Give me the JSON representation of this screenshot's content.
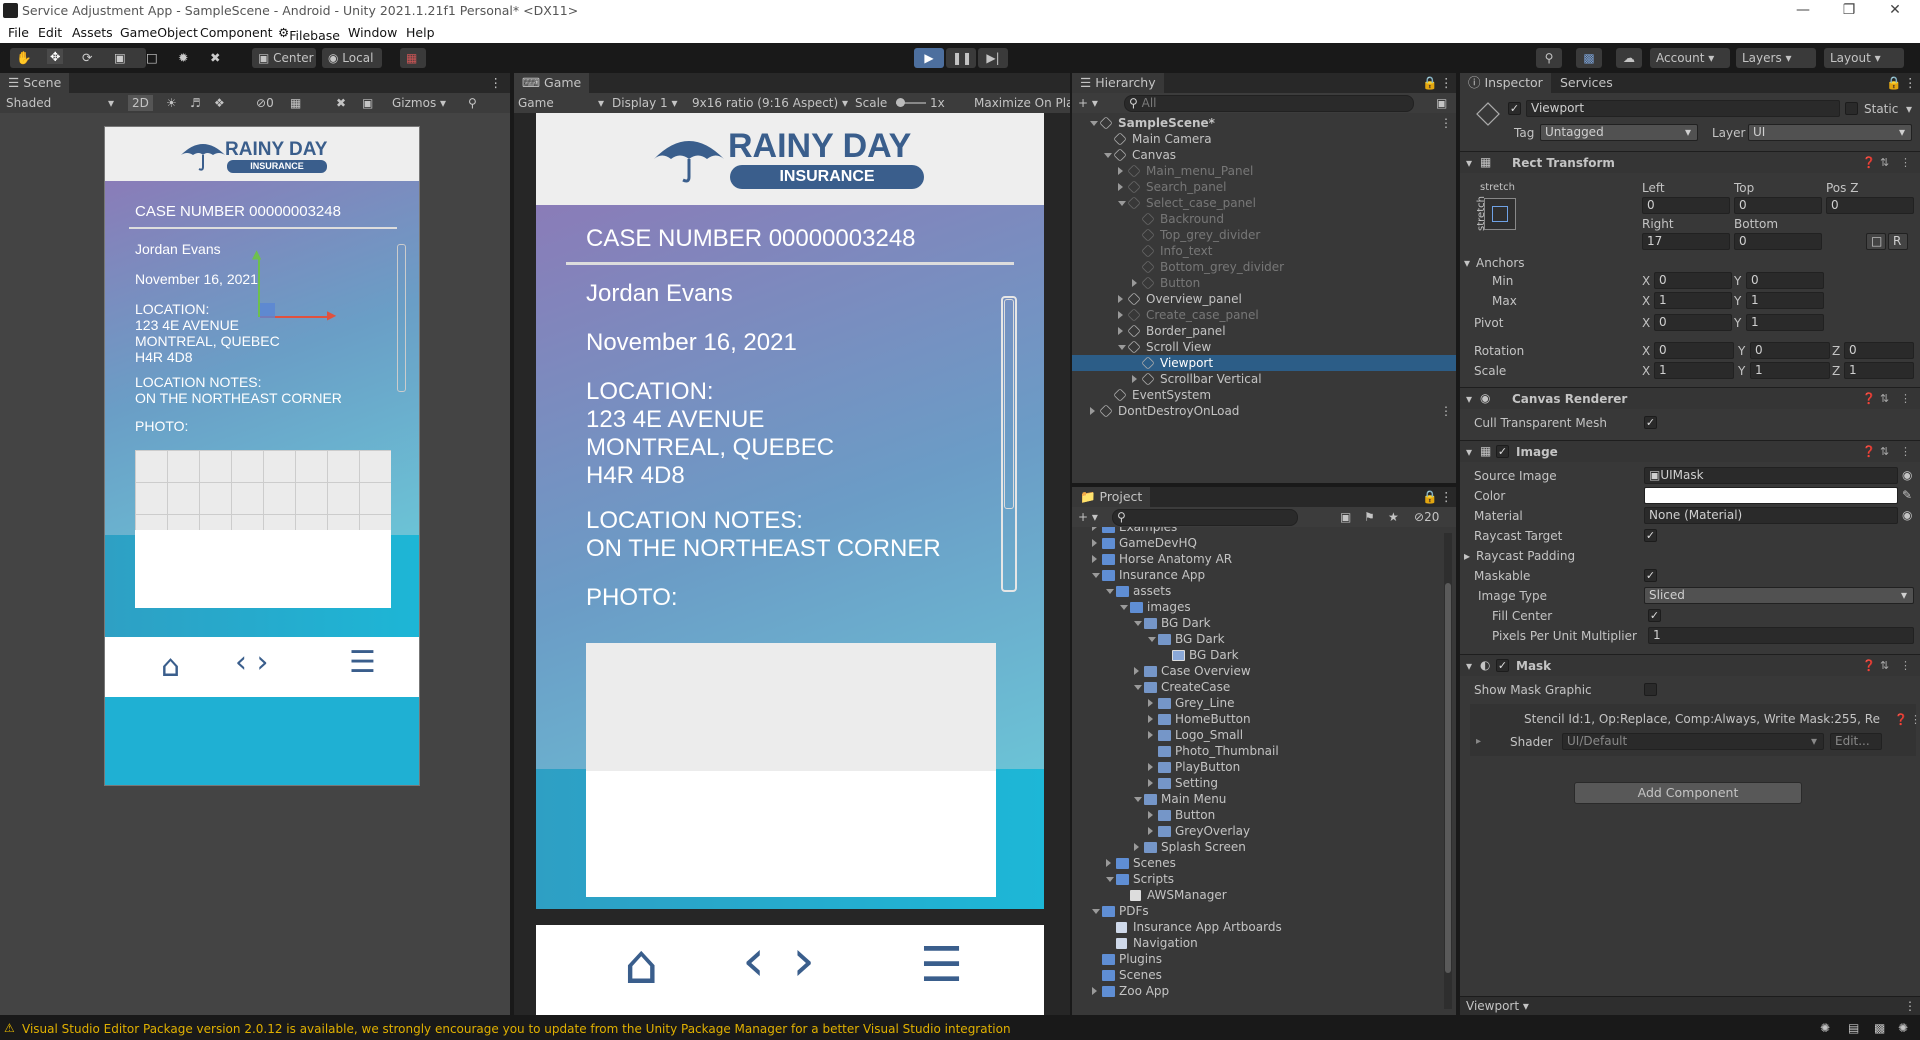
{
  "window": {
    "title": "Service Adjustment App - SampleScene - Android - Unity 2021.1.21f1 Personal* <DX11>"
  },
  "menu": [
    "File",
    "Edit",
    "Assets",
    "GameObject",
    "Component",
    "Filebase",
    "Window",
    "Help"
  ],
  "toolbar": {
    "center": "Center",
    "local": "Local",
    "account": "Account",
    "layers": "Layers",
    "layout": "Layout"
  },
  "scene": {
    "tab": "Scene",
    "shading": "Shaded",
    "mode2d": "2D",
    "gizmos": "Gizmos",
    "hidden_count": "0",
    "search": "All"
  },
  "game": {
    "tab": "Game",
    "view": "Game",
    "display": "Display 1",
    "aspect": "9x16 ratio (9:16 Aspect)",
    "scale_label": "Scale",
    "scale_value": "1x",
    "maximize": "Maximize On Pla"
  },
  "app": {
    "brand1": "RAINY DAY",
    "brand2": "INSURANCE",
    "case": "CASE NUMBER 00000003248",
    "name": "Jordan Evans",
    "date": "November 16, 2021",
    "loc_label": "LOCATION:",
    "loc1": "123 4E AVENUE",
    "loc2": "MONTREAL, QUEBEC",
    "loc3": "H4R 4D8",
    "notes_label": "LOCATION NOTES:",
    "notes": "ON THE NORTHEAST CORNER",
    "photo": "PHOTO:"
  },
  "hierarchy": {
    "tab": "Hierarchy",
    "search": "All",
    "items": [
      {
        "label": "SampleScene*",
        "depth": 0,
        "open": true,
        "dim": false,
        "kind": "scene"
      },
      {
        "label": "Main Camera",
        "depth": 1,
        "open": null,
        "dim": false,
        "kind": "go"
      },
      {
        "label": "Canvas",
        "depth": 1,
        "open": true,
        "dim": false,
        "kind": "go"
      },
      {
        "label": "Main_menu_Panel",
        "depth": 2,
        "open": false,
        "dim": true,
        "kind": "go"
      },
      {
        "label": "Search_panel",
        "depth": 2,
        "open": false,
        "dim": true,
        "kind": "go"
      },
      {
        "label": "Select_case_panel",
        "depth": 2,
        "open": true,
        "dim": true,
        "kind": "go"
      },
      {
        "label": "Backround",
        "depth": 3,
        "open": null,
        "dim": true,
        "kind": "go"
      },
      {
        "label": "Top_grey_divider",
        "depth": 3,
        "open": null,
        "dim": true,
        "kind": "go"
      },
      {
        "label": "Info_text",
        "depth": 3,
        "open": null,
        "dim": true,
        "kind": "go"
      },
      {
        "label": "Bottom_grey_divider",
        "depth": 3,
        "open": null,
        "dim": true,
        "kind": "go"
      },
      {
        "label": "Button",
        "depth": 3,
        "open": false,
        "dim": true,
        "kind": "go"
      },
      {
        "label": "Overview_panel",
        "depth": 2,
        "open": false,
        "dim": false,
        "kind": "go"
      },
      {
        "label": "Create_case_panel",
        "depth": 2,
        "open": false,
        "dim": true,
        "kind": "go"
      },
      {
        "label": "Border_panel",
        "depth": 2,
        "open": false,
        "dim": false,
        "kind": "go"
      },
      {
        "label": "Scroll View",
        "depth": 2,
        "open": true,
        "dim": false,
        "kind": "go"
      },
      {
        "label": "Viewport",
        "depth": 3,
        "open": null,
        "dim": false,
        "kind": "go",
        "selected": true
      },
      {
        "label": "Scrollbar Vertical",
        "depth": 3,
        "open": false,
        "dim": false,
        "kind": "go"
      },
      {
        "label": "EventSystem",
        "depth": 1,
        "open": null,
        "dim": false,
        "kind": "go"
      },
      {
        "label": "DontDestroyOnLoad",
        "depth": 0,
        "open": false,
        "dim": false,
        "kind": "scene"
      }
    ]
  },
  "project": {
    "tab": "Project",
    "hidden_count": "20",
    "items": [
      {
        "label": "Examples",
        "depth": 1,
        "open": false,
        "kind": "folder"
      },
      {
        "label": "GameDevHQ",
        "depth": 1,
        "open": false,
        "kind": "folder"
      },
      {
        "label": "Horse Anatomy AR",
        "depth": 1,
        "open": false,
        "kind": "folder"
      },
      {
        "label": "Insurance App",
        "depth": 1,
        "open": true,
        "kind": "folder"
      },
      {
        "label": "assets",
        "depth": 2,
        "open": true,
        "kind": "folder"
      },
      {
        "label": "images",
        "depth": 3,
        "open": true,
        "kind": "folder"
      },
      {
        "label": "BG Dark",
        "depth": 4,
        "open": true,
        "kind": "image"
      },
      {
        "label": "BG Dark",
        "depth": 5,
        "open": true,
        "kind": "image"
      },
      {
        "label": "BG Dark",
        "depth": 6,
        "open": null,
        "kind": "sprite"
      },
      {
        "label": "Case Overview",
        "depth": 4,
        "open": false,
        "kind": "image"
      },
      {
        "label": "CreateCase",
        "depth": 4,
        "open": true,
        "kind": "image"
      },
      {
        "label": "Grey_Line",
        "depth": 5,
        "open": false,
        "kind": "image"
      },
      {
        "label": "HomeButton",
        "depth": 5,
        "open": false,
        "kind": "image"
      },
      {
        "label": "Logo_Small",
        "depth": 5,
        "open": false,
        "kind": "image"
      },
      {
        "label": "Photo_Thumbnail",
        "depth": 5,
        "open": null,
        "kind": "image"
      },
      {
        "label": "PlayButton",
        "depth": 5,
        "open": false,
        "kind": "image"
      },
      {
        "label": "Setting",
        "depth": 5,
        "open": false,
        "kind": "image"
      },
      {
        "label": "Main Menu",
        "depth": 4,
        "open": true,
        "kind": "image"
      },
      {
        "label": "Button",
        "depth": 5,
        "open": false,
        "kind": "image"
      },
      {
        "label": "GreyOverlay",
        "depth": 5,
        "open": false,
        "kind": "image"
      },
      {
        "label": "Splash Screen",
        "depth": 4,
        "open": false,
        "kind": "image"
      },
      {
        "label": "Scenes",
        "depth": 2,
        "open": false,
        "kind": "folder"
      },
      {
        "label": "Scripts",
        "depth": 2,
        "open": true,
        "kind": "folder"
      },
      {
        "label": "AWSManager",
        "depth": 3,
        "open": null,
        "kind": "script"
      },
      {
        "label": "PDFs",
        "depth": 1,
        "open": true,
        "kind": "folder"
      },
      {
        "label": "Insurance App Artboards",
        "depth": 2,
        "open": null,
        "kind": "pdf"
      },
      {
        "label": "Navigation",
        "depth": 2,
        "open": null,
        "kind": "pdf"
      },
      {
        "label": "Plugins",
        "depth": 1,
        "open": null,
        "kind": "folder"
      },
      {
        "label": "Scenes",
        "depth": 1,
        "open": null,
        "kind": "folder"
      },
      {
        "label": "Zoo App",
        "depth": 1,
        "open": false,
        "kind": "folder"
      }
    ]
  },
  "inspector": {
    "tab": "Inspector",
    "tab2": "Services",
    "name": "Viewport",
    "static": "Static",
    "tag_label": "Tag",
    "tag": "Untagged",
    "layer_label": "Layer",
    "layer": "UI",
    "rect": {
      "title": "Rect Transform",
      "stretch": "stretch",
      "stretch_v": "stretch",
      "left_l": "Left",
      "top_l": "Top",
      "posz_l": "Pos Z",
      "left": "0",
      "top": "0",
      "posz": "0",
      "right_l": "Right",
      "bottom_l": "Bottom",
      "right": "17",
      "bottom": "0",
      "r_btn": "R",
      "anchors": "Anchors",
      "min": "Min",
      "max": "Max",
      "pivot": "Pivot",
      "rotation": "Rotation",
      "scale": "Scale",
      "min_x": "0",
      "min_y": "0",
      "max_x": "1",
      "max_y": "1",
      "pivot_x": "0",
      "pivot_y": "1",
      "rot_x": "0",
      "rot_y": "0",
      "rot_z": "0",
      "scale_x": "1",
      "scale_y": "1",
      "scale_z": "1"
    },
    "canvas_renderer": {
      "title": "Canvas Renderer",
      "cull": "Cull Transparent Mesh"
    },
    "image": {
      "title": "Image",
      "source_l": "Source Image",
      "source": "UIMask",
      "color_l": "Color",
      "material_l": "Material",
      "material": "None (Material)",
      "raycast": "Raycast Target",
      "padding": "Raycast Padding",
      "maskable": "Maskable",
      "type_l": "Image Type",
      "type": "Sliced",
      "fill": "Fill Center",
      "ppu_l": "Pixels Per Unit Multiplier",
      "ppu": "1"
    },
    "mask": {
      "title": "Mask",
      "show": "Show Mask Graphic",
      "stencil": "Stencil Id:1, Op:Replace, Comp:Always, Write Mask:255, Re",
      "shader_l": "Shader",
      "shader": "UI/Default",
      "edit": "Edit..."
    },
    "add": "Add Component",
    "footer": "Viewport"
  },
  "status": {
    "msg": "Visual Studio Editor Package version 2.0.12 is available, we strongly encourage you to update from the Unity Package Manager for a better Visual Studio integration"
  },
  "colors": {
    "brand": "#3a5e8c",
    "selected": "#2c5d87",
    "panel": "#383838"
  }
}
